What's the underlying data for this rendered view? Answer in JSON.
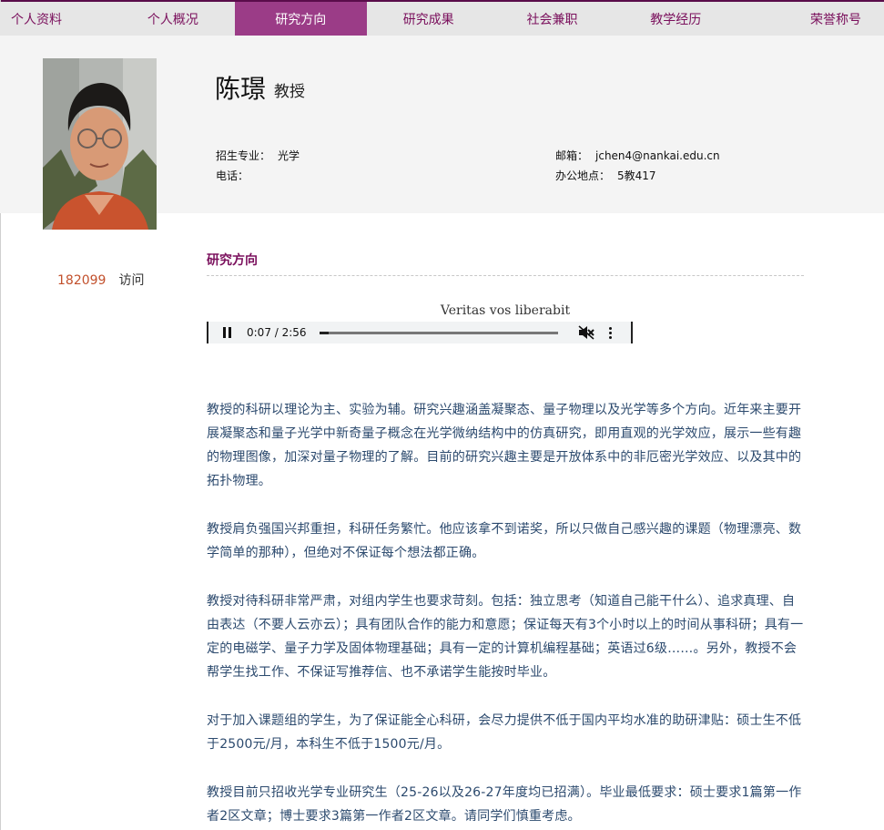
{
  "nav": {
    "items": [
      "个人资料",
      "个人概况",
      "研究方向",
      "研究成果",
      "社会兼职",
      "教学经历",
      "荣誉称号"
    ],
    "active_index": 2
  },
  "profile": {
    "name": "陈璟",
    "title": "教授",
    "major_label": "招生专业：",
    "major_value": "光学",
    "phone_label": "电话：",
    "phone_value": "",
    "email_label": "邮箱：",
    "email_value": "jchen4@nankai.edu.cn",
    "office_label": "办公地点：",
    "office_value": "5教417"
  },
  "visits": {
    "count": "182099",
    "label": "访问"
  },
  "section": {
    "title": "研究方向"
  },
  "audio": {
    "caption": "Veritas vos liberabit",
    "time": "0:07 / 2:56",
    "progress": 0.04
  },
  "paragraphs": [
    "教授的科研以理论为主、实验为辅。研究兴趣涵盖凝聚态、量子物理以及光学等多个方向。近年来主要开展凝聚态和量子光学中新奇量子概念在光学微纳结构中的仿真研究，即用直观的光学效应，展示一些有趣的物理图像，加深对量子物理的了解。目前的研究兴趣主要是开放体系中的非厄密光学效应、以及其中的拓扑物理。",
    "教授肩负强国兴邦重担，科研任务繁忙。他应该拿不到诺奖，所以只做自己感兴趣的课题（物理漂亮、数学简单的那种），但绝对不保证每个想法都正确。",
    "教授对待科研非常严肃，对组内学生也要求苛刻。包括：独立思考（知道自己能干什么）、追求真理、自由表达（不要人云亦云）；具有团队合作的能力和意愿；保证每天有3个小时以上的时间从事科研；具有一定的电磁学、量子力学及固体物理基础；具有一定的计算机编程基础；英语过6级……。另外，教授不会帮学生找工作、不保证写推荐信、也不承诺学生能按时毕业。",
    "对于加入课题组的学生，为了保证能全心科研，会尽力提供不低于国内平均水准的助研津贴：硕士生不低于2500元/月，本科生不低于1500元/月。",
    "教授目前只招收光学专业研究生（25-26以及26-27年度均已招满）。毕业最低要求：硕士要求1篇第一作者2区文章；博士要求3篇第一作者2区文章。请同学们慎重考虑。"
  ]
}
